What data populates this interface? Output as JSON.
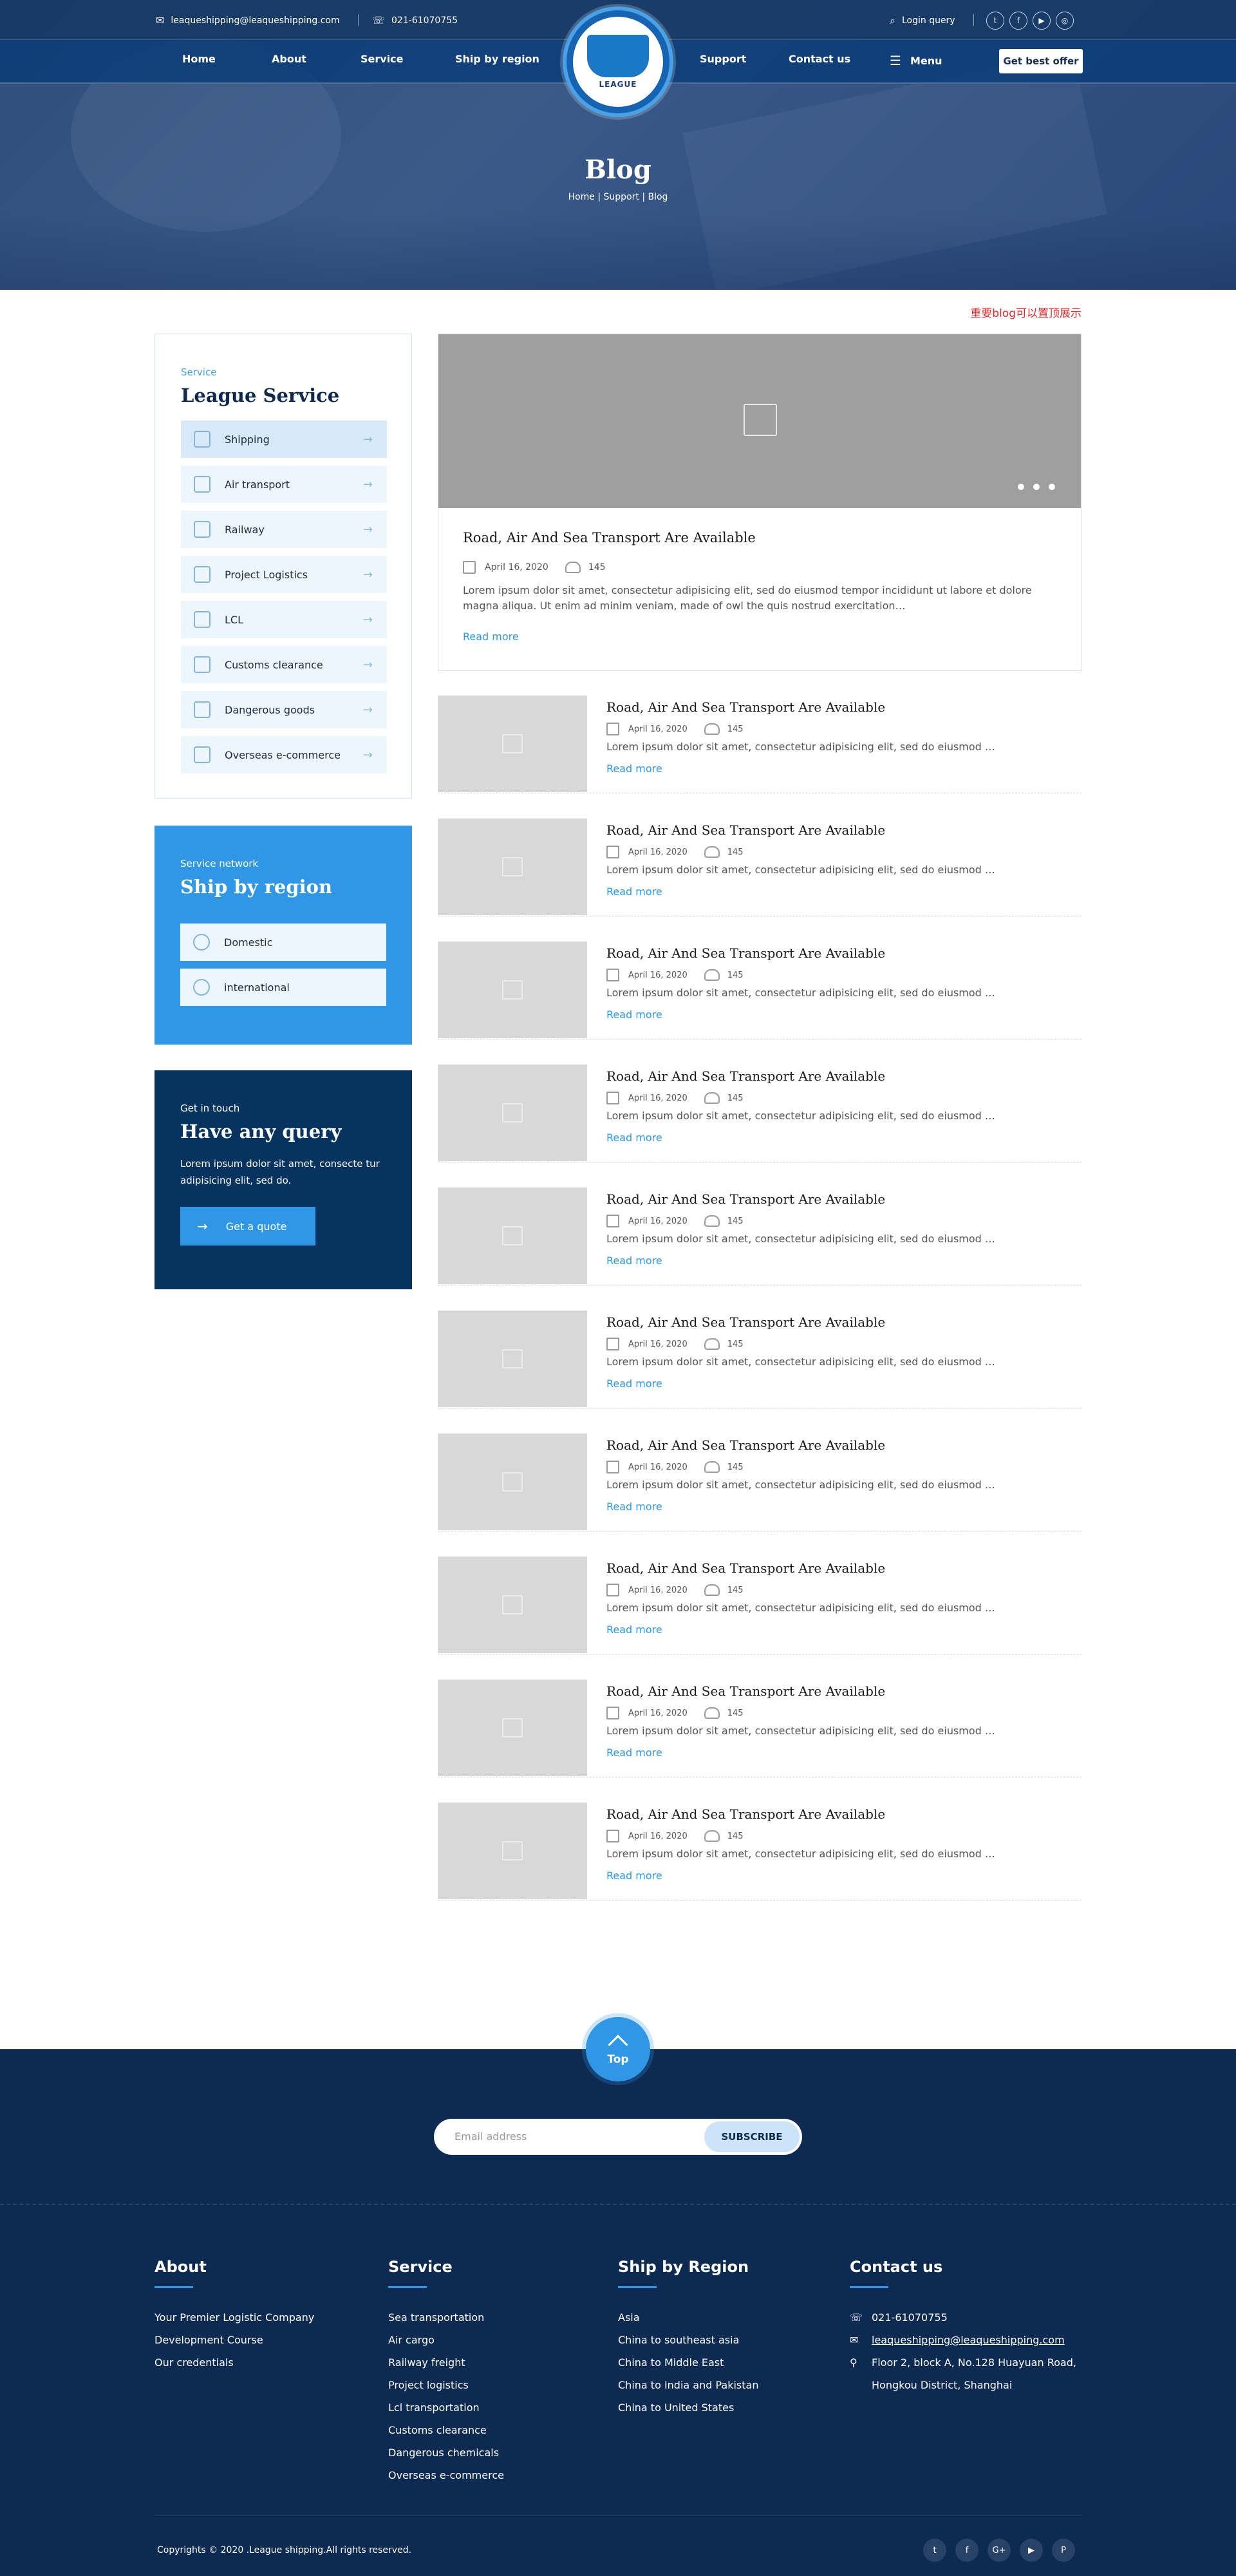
{
  "topbar": {
    "email": "leaqueshipping@leaqueshipping.com",
    "phone": "021-61070755",
    "login": "Login query",
    "social": [
      "t",
      "f",
      "▶",
      "◎"
    ]
  },
  "nav": {
    "home": "Home",
    "about": "About",
    "service": "Service",
    "ship_by_region": "Ship by region",
    "support": "Support",
    "contact": "Contact us",
    "menu": "Menu",
    "best_offer": "Get best offer",
    "logo_text": "LEAGUE"
  },
  "hero": {
    "title": "Blog",
    "breadcrumb": "Home | Support | Blog"
  },
  "note": "重要blog可以置顶展示",
  "sidebar": {
    "kicker": "Service",
    "title": "League Service",
    "items": [
      {
        "label": "Shipping"
      },
      {
        "label": "Air transport"
      },
      {
        "label": "Railway"
      },
      {
        "label": "Project Logistics"
      },
      {
        "label": "LCL"
      },
      {
        "label": "Customs clearance"
      },
      {
        "label": "Dangerous goods"
      },
      {
        "label": "Overseas e-commerce"
      }
    ],
    "arrow": "→"
  },
  "region": {
    "kicker": "Service network",
    "title": "Ship by region",
    "items": [
      {
        "label": "Domestic"
      },
      {
        "label": "international"
      }
    ]
  },
  "query": {
    "kicker": "Get in touch",
    "title": "Have any query",
    "desc": "Lorem ipsum dolor sit amet, consecte tur adipisicing elit, sed do.",
    "button": "Get a quote",
    "arrow": "→"
  },
  "featured": {
    "title": "Road, Air And Sea Transport Are Available",
    "date": "April 16, 2020",
    "views": "145",
    "desc": "Lorem ipsum dolor sit amet, consectetur adipisicing elit, sed do eiusmod tempor incididunt ut labore et dolore magna aliqua. Ut enim ad minim veniam, made of owl the quis nostrud exercitation…",
    "read_more": "Read more"
  },
  "posts": [
    {
      "title": "Road, Air And Sea Transport Are Available",
      "date": "April 16, 2020",
      "views": "145",
      "desc": "Lorem ipsum dolor sit amet, consectetur adipisicing elit, sed do eiusmod  …",
      "read_more": "Read more"
    },
    {
      "title": "Road, Air And Sea Transport Are Available",
      "date": "April 16, 2020",
      "views": "145",
      "desc": "Lorem ipsum dolor sit amet, consectetur adipisicing elit, sed do eiusmod  …",
      "read_more": "Read more"
    },
    {
      "title": "Road, Air And Sea Transport Are Available",
      "date": "April 16, 2020",
      "views": "145",
      "desc": "Lorem ipsum dolor sit amet, consectetur adipisicing elit, sed do eiusmod  …",
      "read_more": "Read more"
    },
    {
      "title": "Road, Air And Sea Transport Are Available",
      "date": "April 16, 2020",
      "views": "145",
      "desc": "Lorem ipsum dolor sit amet, consectetur adipisicing elit, sed do eiusmod  …",
      "read_more": "Read more"
    },
    {
      "title": "Road, Air And Sea Transport Are Available",
      "date": "April 16, 2020",
      "views": "145",
      "desc": "Lorem ipsum dolor sit amet, consectetur adipisicing elit, sed do eiusmod  …",
      "read_more": "Read more"
    },
    {
      "title": "Road, Air And Sea Transport Are Available",
      "date": "April 16, 2020",
      "views": "145",
      "desc": "Lorem ipsum dolor sit amet, consectetur adipisicing elit, sed do eiusmod  …",
      "read_more": "Read more"
    },
    {
      "title": "Road, Air And Sea Transport Are Available",
      "date": "April 16, 2020",
      "views": "145",
      "desc": "Lorem ipsum dolor sit amet, consectetur adipisicing elit, sed do eiusmod  …",
      "read_more": "Read more"
    },
    {
      "title": "Road, Air And Sea Transport Are Available",
      "date": "April 16, 2020",
      "views": "145",
      "desc": "Lorem ipsum dolor sit amet, consectetur adipisicing elit, sed do eiusmod  …",
      "read_more": "Read more"
    },
    {
      "title": "Road, Air And Sea Transport Are Available",
      "date": "April 16, 2020",
      "views": "145",
      "desc": "Lorem ipsum dolor sit amet, consectetur adipisicing elit, sed do eiusmod  …",
      "read_more": "Read more"
    },
    {
      "title": "Road, Air And Sea Transport Are Available",
      "date": "April 16, 2020",
      "views": "145",
      "desc": "Lorem ipsum dolor sit amet, consectetur adipisicing elit, sed do eiusmod  …",
      "read_more": "Read more"
    }
  ],
  "top_button": "Top",
  "footer": {
    "subscribe": {
      "placeholder": "Email address",
      "button": "SUBSCRIBE"
    },
    "about": {
      "title": "About",
      "items": [
        "Your Premier Logistic Company",
        "Development Course",
        "Our credentials"
      ]
    },
    "service": {
      "title": "Service",
      "items": [
        "Sea transportation",
        "Air cargo",
        "Railway freight",
        "Project logistics",
        "Lcl transportation",
        "Customs clearance",
        "Dangerous chemicals",
        "Overseas e-commerce"
      ]
    },
    "region": {
      "title": "Ship by Region",
      "items": [
        "Asia",
        "China to southeast asia",
        "China to Middle East",
        "China to  India and Pakistan",
        "China to  United States"
      ]
    },
    "contact": {
      "title": "Contact us",
      "phone": "021-61070755",
      "email": "leaqueshipping@leaqueshipping.com",
      "address1": "Floor 2, block A, No.128 Huayuan Road,",
      "address2": "Hongkou District, Shanghai"
    },
    "copyright": "Copyrights © 2020 .League shipping.All rights reserved.",
    "social": [
      "t",
      "f",
      "G+",
      "▶",
      "P"
    ]
  }
}
